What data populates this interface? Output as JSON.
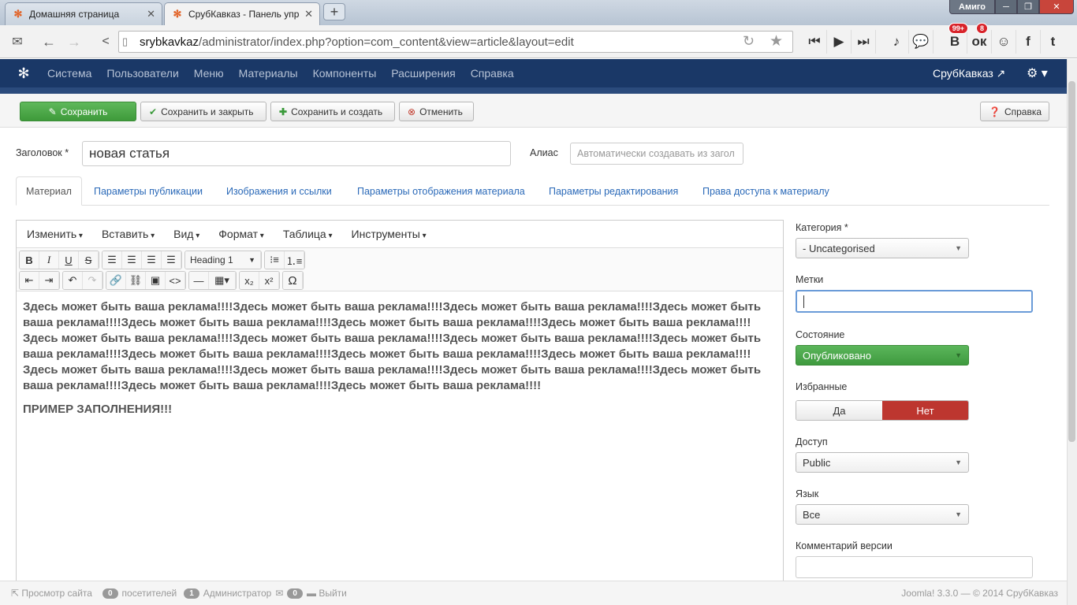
{
  "browser": {
    "tabs": [
      {
        "label": "Домашняя страница",
        "close": "✕"
      },
      {
        "label": "СрубКавказ - Панель упра",
        "close": "✕"
      }
    ],
    "new_tab": "+",
    "window": {
      "profile": "Амиго",
      "minimize": "─",
      "maximize": "❐",
      "close": "✕"
    },
    "url_host": "srybkavkaz",
    "url_path": "/administrator/index.php?option=com_content&view=article&layout=edit",
    "badges": {
      "vk": "99+",
      "ok": "8"
    },
    "social": {
      "vk": "В",
      "ok": "ок",
      "fb": "f",
      "tw": "t"
    }
  },
  "jnav": {
    "items": [
      "Система",
      "Пользователи",
      "Меню",
      "Материалы",
      "Компоненты",
      "Расширения",
      "Справка"
    ],
    "site_name": "СрубКавказ",
    "gear": "⚙ ▾"
  },
  "toolbar": {
    "save": "Сохранить",
    "save_close": "Сохранить и закрыть",
    "save_new": "Сохранить и создать",
    "cancel": "Отменить",
    "help": "Справка"
  },
  "form": {
    "title_label": "Заголовок *",
    "title_value": "новая статья",
    "alias_label": "Алиас",
    "alias_placeholder": "Автоматически создавать из загол"
  },
  "tabs": [
    "Материал",
    "Параметры публикации",
    "Изображения и ссылки",
    "Параметры отображения материала",
    "Параметры редактирования",
    "Права доступа к материалу"
  ],
  "editor": {
    "menu": [
      "Изменить",
      "Вставить",
      "Вид",
      "Формат",
      "Таблица",
      "Инструменты"
    ],
    "format_select": "Heading 1",
    "content": [
      "Здесь может быть ваша реклама!!!!Здесь может быть ваша реклама!!!!Здесь может быть ваша реклама!!!!Здесь может быть ваша реклама!!!!Здесь может быть ваша реклама!!!!Здесь может быть ваша реклама!!!!Здесь может быть ваша реклама!!!!Здесь может быть ваша реклама!!!!Здесь может быть ваша реклама!!!!Здесь может быть ваша реклама!!!!Здесь может быть ваша реклама!!!!Здесь может быть ваша реклама!!!!Здесь может быть ваша реклама!!!!Здесь может быть ваша реклама!!!!Здесь может быть ваша реклама!!!!Здесь может быть ваша реклама!!!!Здесь может быть ваша реклама!!!!Здесь может быть ваша реклама!!!!Здесь может быть ваша реклама!!!!Здесь может быть ваша реклама!!!!",
      "ПРИМЕР ЗАПОЛНЕНИЯ!!!"
    ]
  },
  "side": {
    "category_label": "Категория *",
    "category_value": "- Uncategorised",
    "tags_label": "Метки",
    "state_label": "Состояние",
    "state_value": "Опубликовано",
    "featured_label": "Избранные",
    "featured_yes": "Да",
    "featured_no": "Нет",
    "access_label": "Доступ",
    "access_value": "Public",
    "language_label": "Язык",
    "language_value": "Все",
    "version_label": "Комментарий версии"
  },
  "status": {
    "view_site": "Просмотр сайта",
    "visitors_count": "0",
    "visitors_label": "посетителей",
    "admins_count": "1",
    "admins_label": "Администратор",
    "messages_count": "0",
    "logout": "Выйти",
    "copyright": "Joomla! 3.3.0 — © 2014 СрубКавказ"
  },
  "colors": {
    "joomla_nav": "#1a3867",
    "save_green": "#4aa845",
    "published_green": "#46a546",
    "no_red": "#bd362f"
  }
}
